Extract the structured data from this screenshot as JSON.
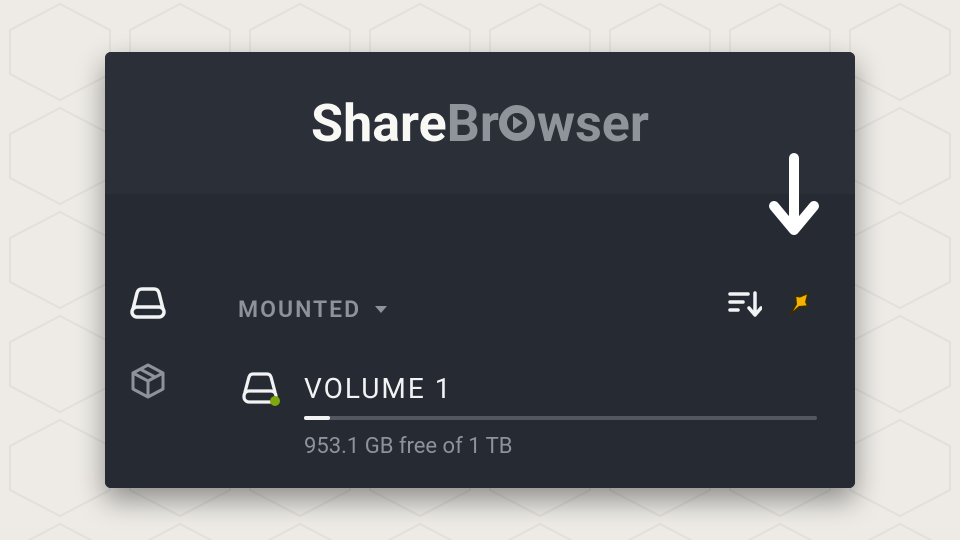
{
  "logo": {
    "part_a": "Share",
    "part_b_prefix": "Br",
    "part_b_suffix": "wser"
  },
  "filter": {
    "label": "MOUNTED"
  },
  "volume": {
    "name": "VOLUME 1",
    "subtext": "953.1 GB free of 1 TB",
    "used_percent": 5
  },
  "colors": {
    "accent": "#f5b300",
    "mounted_dot": "#7ea80e"
  }
}
